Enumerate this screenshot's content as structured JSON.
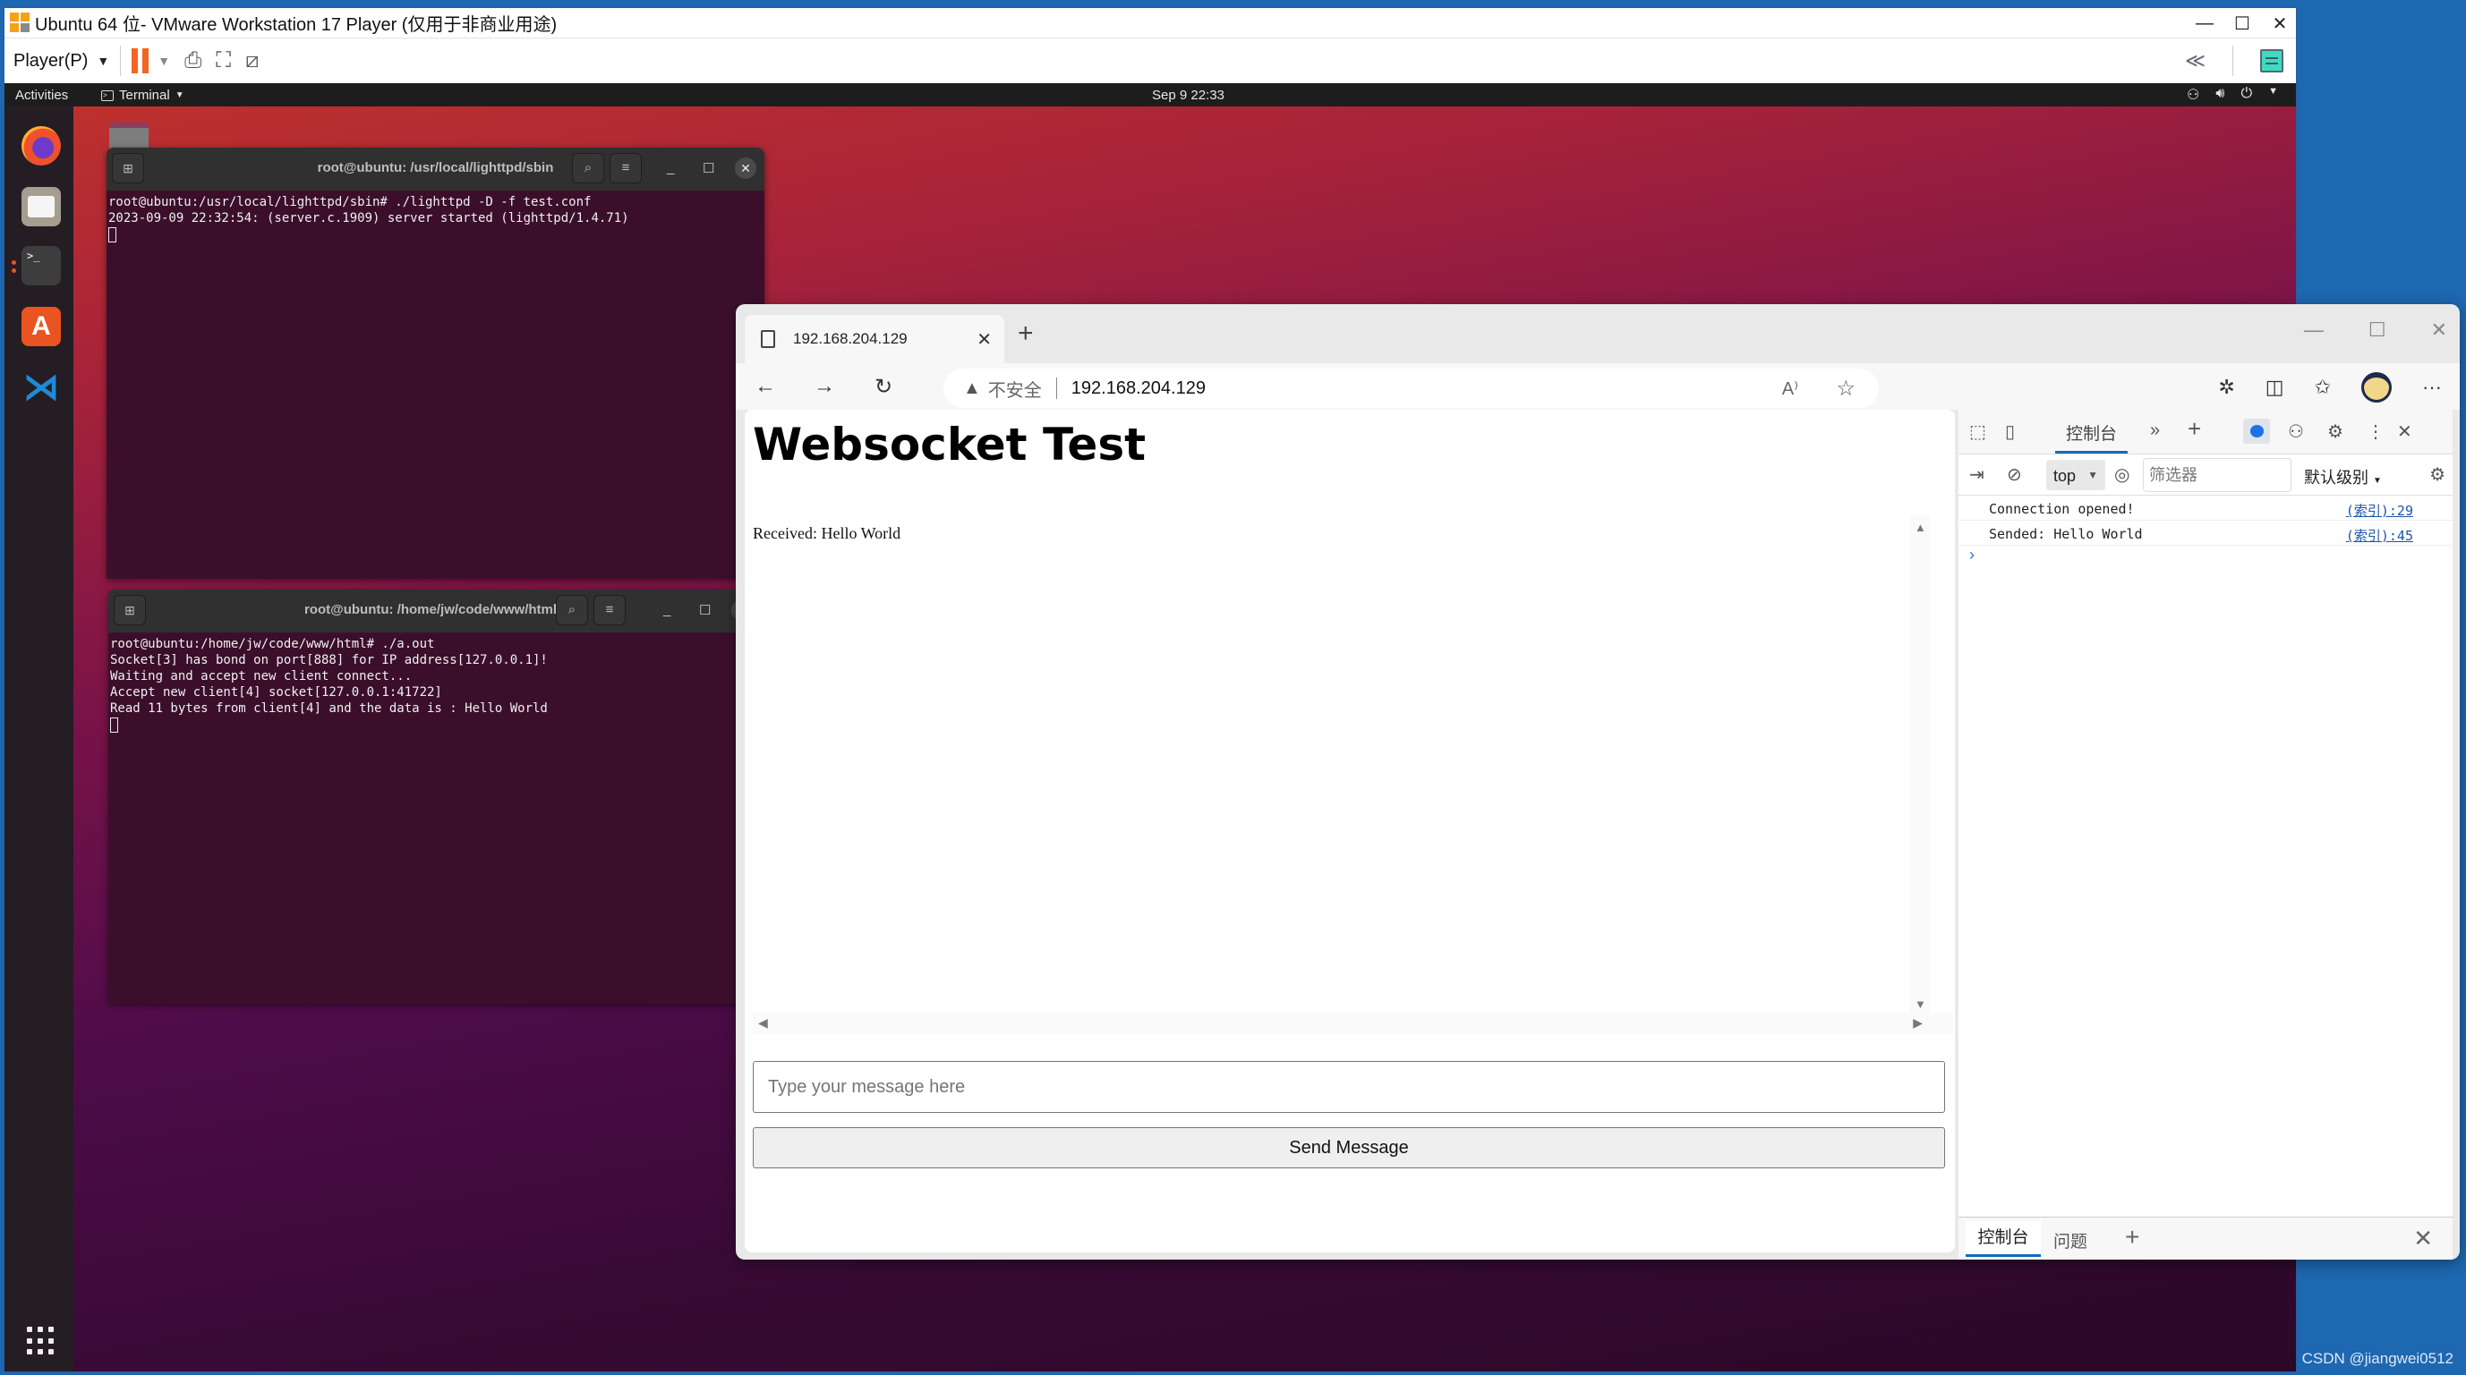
{
  "vmware": {
    "title": "Ubuntu 64 位- VMware Workstation 17 Player (仅用于非商业用途)",
    "player_menu": "Player(P)",
    "window_controls": [
      "—",
      "☐",
      "✕"
    ],
    "collapse_label": "≪"
  },
  "ubuntu": {
    "activities": "Activities",
    "app_menu": "Terminal",
    "clock": "Sep 9  22:33",
    "dock": [
      {
        "name": "firefox",
        "label": ""
      },
      {
        "name": "files",
        "label": ""
      },
      {
        "name": "terminal",
        "label": ">_"
      },
      {
        "name": "software",
        "label": "A"
      },
      {
        "name": "vscode",
        "label": "⋊"
      }
    ]
  },
  "terminal1": {
    "title": "root@ubuntu: /usr/local/lighttpd/sbin",
    "lines": [
      "root@ubuntu:/usr/local/lighttpd/sbin# ./lighttpd -D -f test.conf",
      "2023-09-09 22:32:54: (server.c.1909) server started (lighttpd/1.4.71)"
    ]
  },
  "terminal2": {
    "title": "root@ubuntu: /home/jw/code/www/html",
    "lines": [
      "root@ubuntu:/home/jw/code/www/html# ./a.out",
      "Socket[3] has bond on port[888] for IP address[127.0.0.1]!",
      "Waiting and accept new client connect...",
      "Accept new client[4] socket[127.0.0.1:41722]",
      "Read 11 bytes from client[4] and the data is : Hello World"
    ]
  },
  "browser": {
    "tab_title": "192.168.204.129",
    "new_tab": "+",
    "insecure_label": "不安全",
    "url": "192.168.204.129",
    "window_controls": [
      "—",
      "☐",
      "✕"
    ]
  },
  "page": {
    "heading": "Websocket Test",
    "received": "Received: Hello World",
    "input_placeholder": "Type your message here",
    "input_value": "",
    "send_button": "Send Message"
  },
  "devtools": {
    "console_tab": "控制台",
    "context": "top",
    "filter_placeholder": "筛选器",
    "level": "默认级别",
    "logs": [
      {
        "message": "Connection opened!",
        "source": "(索引):29"
      },
      {
        "message": "Sended: Hello World",
        "source": "(索引):45"
      }
    ],
    "drawer_tabs": [
      "控制台",
      "问题"
    ]
  },
  "watermark": "CSDN @jiangwei0512"
}
